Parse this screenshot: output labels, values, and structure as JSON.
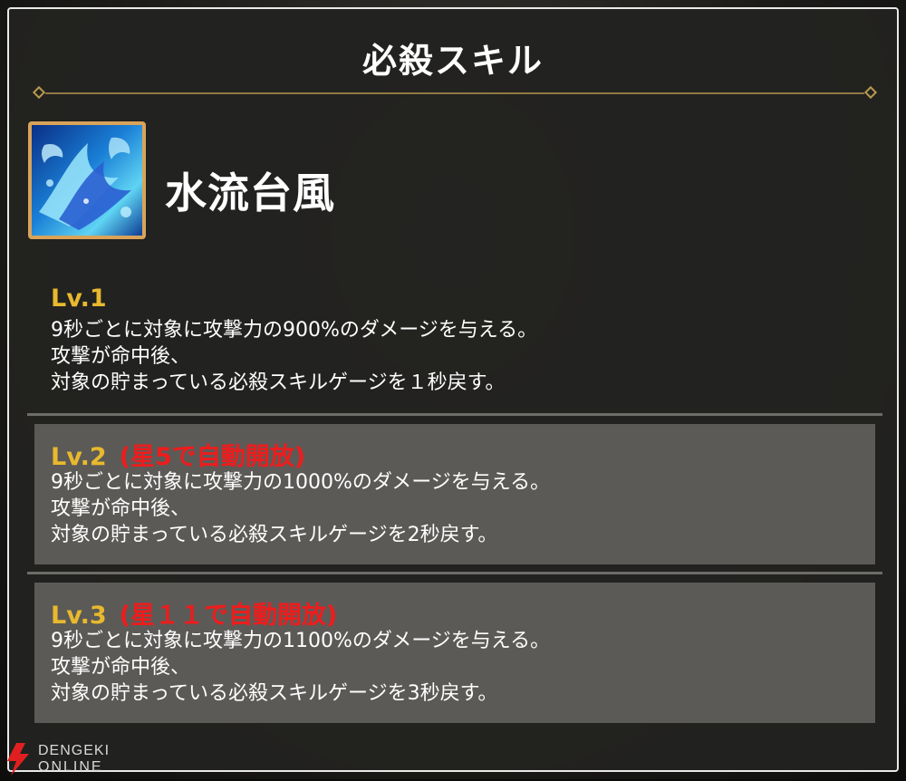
{
  "header": {
    "title": "必殺スキル"
  },
  "skill": {
    "name": "水流台風",
    "icon": "water-splash-icon"
  },
  "levels": [
    {
      "level_label": "Lv.1",
      "unlock_note": "",
      "lines": [
        "9秒ごとに対象に攻撃力の900%のダメージを与える。",
        "攻撃が命中後、",
        "対象の貯まっている必殺スキルゲージを１秒戻す。"
      ]
    },
    {
      "level_label": "Lv.2",
      "unlock_note": "(星5で自動開放)",
      "lines": [
        "9秒ごとに対象に攻撃力の1000%のダメージを与える。",
        "攻撃が命中後、",
        "対象の貯まっている必殺スキルゲージを2秒戻す。"
      ]
    },
    {
      "level_label": "Lv.3",
      "unlock_note": "(星１１で自動開放)",
      "lines": [
        "9秒ごとに対象に攻撃力の1100%のダメージを与える。",
        "攻撃が命中後、",
        "対象の貯まっている必殺スキルゲージを3秒戻す。"
      ]
    }
  ],
  "watermark": {
    "line1": "DENGEKI",
    "line2": "ONLINE"
  },
  "colors": {
    "level_label": "#e8b92e",
    "unlock_note": "#ee1c1c",
    "panel_border": "#e9e9e9",
    "locked_level_bg": "#5c5a57",
    "ornament": "#8f7a44"
  }
}
